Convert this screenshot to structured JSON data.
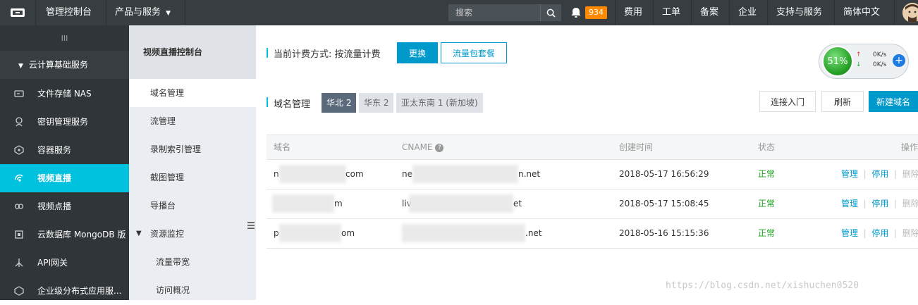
{
  "topbar": {
    "console": "管理控制台",
    "products": "产品与服务",
    "search_placeholder": "搜索",
    "notifications": "934",
    "links": [
      "费用",
      "工单",
      "备案",
      "企业",
      "支持与服务",
      "简体中文"
    ]
  },
  "sidebar": {
    "handle": "III",
    "group": "云计算基础服务",
    "items": [
      "文件存储 NAS",
      "密钥管理服务",
      "容器服务",
      "视频直播",
      "视频点播",
      "云数据库 MongoDB 版",
      "API网关",
      "企业级分布式应用服..."
    ]
  },
  "subnav": {
    "title": "视频直播控制台",
    "items": [
      "域名管理",
      "流管理",
      "录制索引管理",
      "截图管理",
      "导播台",
      "资源监控",
      "流量带宽",
      "访问概况"
    ]
  },
  "billing": {
    "label": "当前计费方式: 按流量计费",
    "change": "更换",
    "package": "流量包套餐"
  },
  "gauge": {
    "percent": "51%",
    "up": "0K/s",
    "down": "0K/s"
  },
  "domains": {
    "title": "域名管理",
    "regions": [
      "华北 2",
      "华东 2",
      "亚太东南 1 (新加坡)"
    ],
    "actions": [
      "连接入门",
      "刷新",
      "新建域名"
    ]
  },
  "table": {
    "headers": [
      "域名",
      "CNAME",
      "创建时间",
      "状态",
      "操作"
    ],
    "rows": [
      {
        "domain_prefix": "n",
        "domain_suffix": "com",
        "cname_prefix": "ne",
        "cname_suffix": "n.net",
        "created": "2018-05-17 16:56:29",
        "status": "正常"
      },
      {
        "domain_prefix": "",
        "domain_suffix": "m",
        "cname_prefix": "liv",
        "cname_suffix": "et",
        "created": "2018-05-17 15:08:45",
        "status": "正常"
      },
      {
        "domain_prefix": "p",
        "domain_suffix": "om",
        "cname_prefix": "",
        "cname_suffix": ".net",
        "created": "2018-05-16 15:15:36",
        "status": "正常"
      }
    ],
    "ops": [
      "管理",
      "停用",
      "删除"
    ]
  },
  "watermark": "https://blog.csdn.net/xishuchen0520",
  "colors": {
    "topbar": "#373d41",
    "sidebar": "#2f3539",
    "active": "#00c1de",
    "primary": "#0099cc",
    "ok": "#1fa11f"
  }
}
